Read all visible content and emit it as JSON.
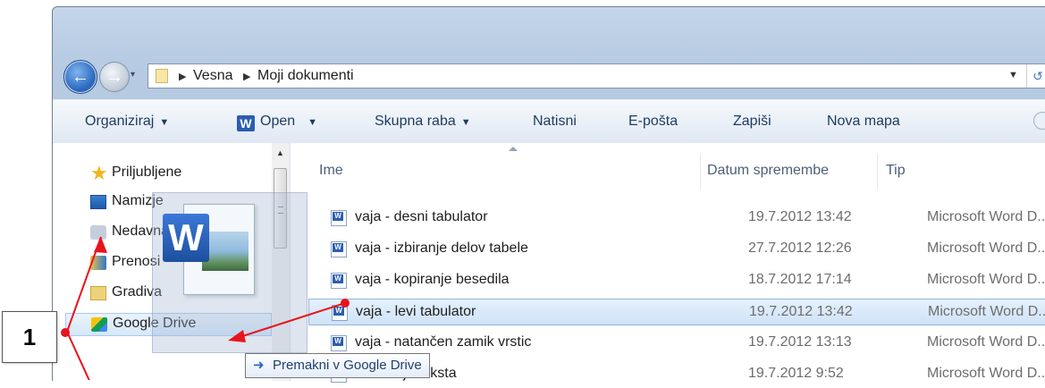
{
  "navigation": {
    "history_arrow": "▾",
    "breadcrumbs": [
      "Vesna",
      "Moji dokumenti"
    ]
  },
  "toolbar": {
    "organize": "Organiziraj",
    "open": "Open",
    "share": "Skupna raba",
    "print": "Natisni",
    "email": "E-pošta",
    "burn": "Zapiši",
    "new_folder": "Nova mapa"
  },
  "sidebar": {
    "favorites": "Priljubljene",
    "items": [
      {
        "label": "Namizje",
        "icon": "desktop-icon"
      },
      {
        "label": "Nedavna mesta",
        "icon": "recent-places-icon"
      },
      {
        "label": "Prenosi",
        "icon": "downloads-icon"
      },
      {
        "label": "Gradiva",
        "icon": "folder-icon"
      },
      {
        "label": "Google Drive",
        "icon": "google-drive-icon"
      }
    ]
  },
  "file_list": {
    "columns": {
      "name": "Ime",
      "date": "Datum spremembe",
      "type": "Tip"
    },
    "files": [
      {
        "name": "vaja - desni tabulator",
        "date": "19.7.2012 13:42",
        "type": "Microsoft Word D..."
      },
      {
        "name": "vaja - izbiranje delov tabele",
        "date": "27.7.2012 12:26",
        "type": "Microsoft Word D..."
      },
      {
        "name": "vaja - kopiranje besedila",
        "date": "18.7.2012 17:14",
        "type": "Microsoft Word D..."
      },
      {
        "name": "vaja - levi tabulator",
        "date": "19.7.2012 13:42",
        "type": "Microsoft Word D...",
        "selected": true
      },
      {
        "name": "vaja - natančen zamik vrstic",
        "date": "19.7.2012 13:13",
        "type": "Microsoft Word D..."
      },
      {
        "name": "je teksta",
        "date": "19.7.2012 9:52",
        "type": "Microsoft Word D..."
      }
    ]
  },
  "drag_tooltip": "Premakni v Google Drive",
  "annotation": {
    "label": "1",
    "color": "#e8141b"
  }
}
